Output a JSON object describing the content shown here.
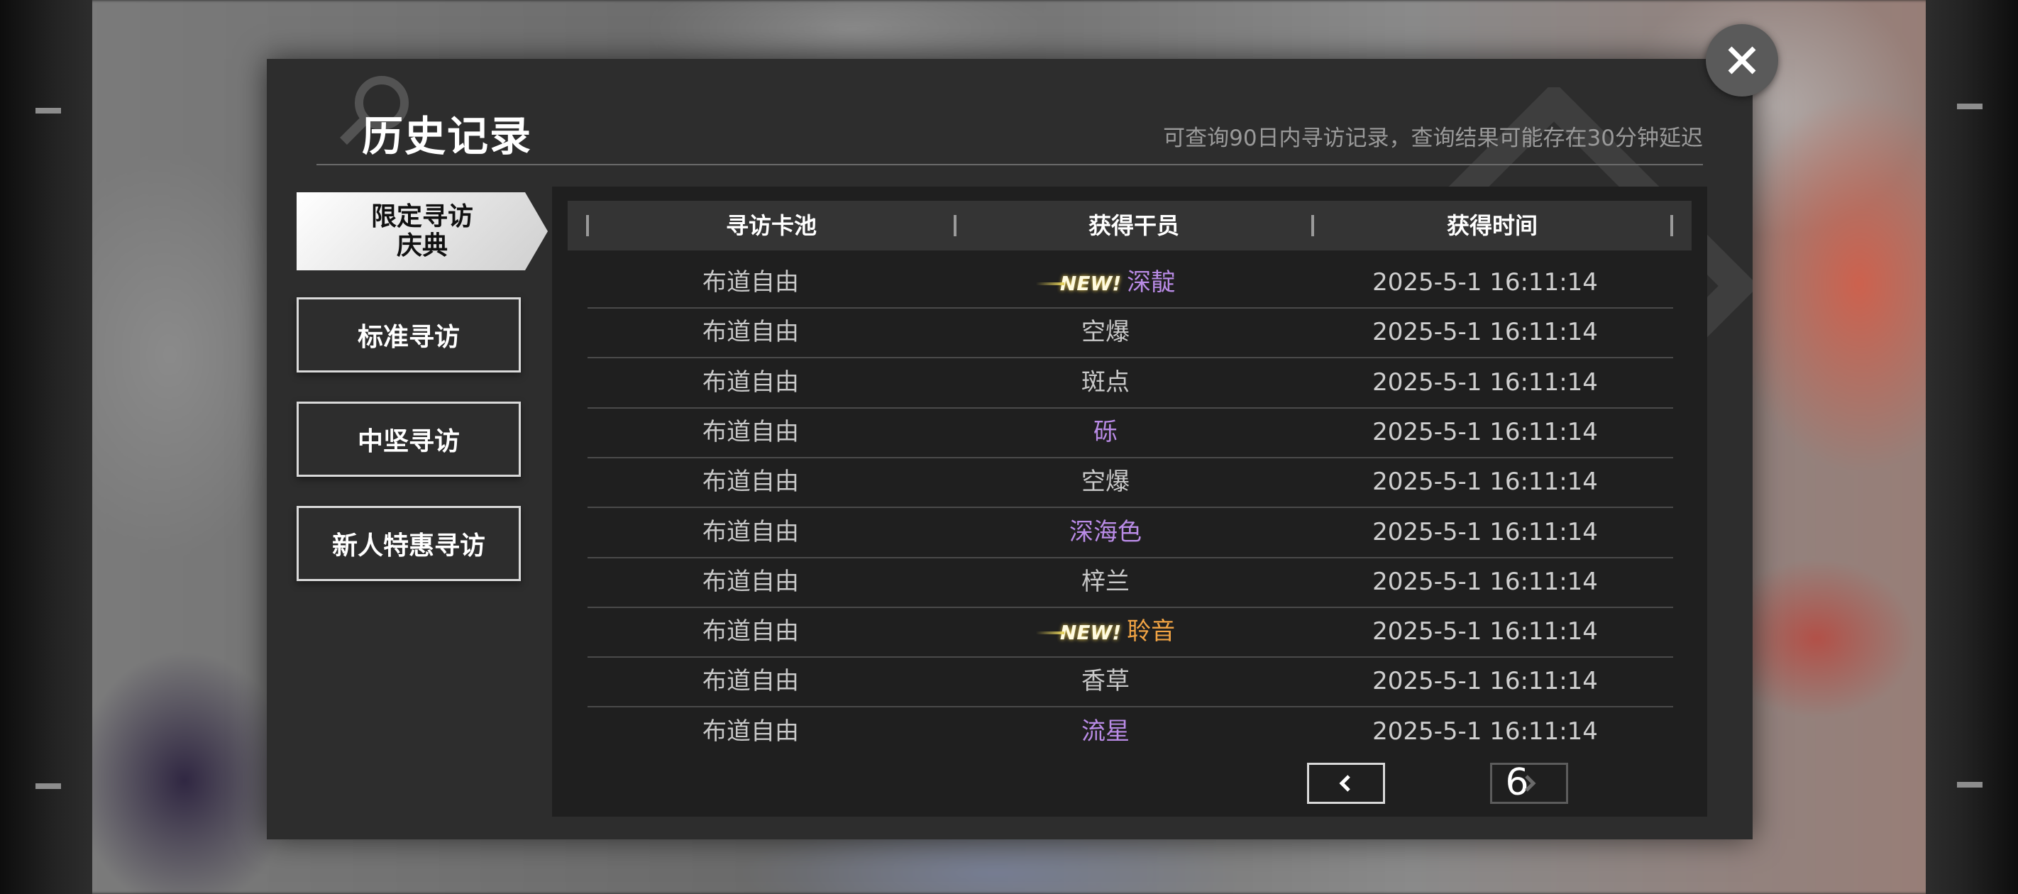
{
  "header": {
    "title": "历史记录",
    "subtitle": "可查询90日内寻访记录，查询结果可能存在30分钟延迟"
  },
  "tabs": [
    {
      "label_line1": "限定寻访",
      "label_line2": "庆典",
      "active": true
    },
    {
      "label": "标准寻访",
      "active": false
    },
    {
      "label": "中坚寻访",
      "active": false
    },
    {
      "label": "新人特惠寻访",
      "active": false
    }
  ],
  "table": {
    "columns": [
      "寻访卡池",
      "获得干员",
      "获得时间"
    ],
    "rows": [
      {
        "pool": "布道自由",
        "operator": "深靛",
        "time": "2025-5-1 16:11:14",
        "new": true,
        "color": "#b98be6"
      },
      {
        "pool": "布道自由",
        "operator": "空爆",
        "time": "2025-5-1 16:11:14",
        "new": false,
        "color": "#c8c8c8"
      },
      {
        "pool": "布道自由",
        "operator": "斑点",
        "time": "2025-5-1 16:11:14",
        "new": false,
        "color": "#c8c8c8"
      },
      {
        "pool": "布道自由",
        "operator": "砾",
        "time": "2025-5-1 16:11:14",
        "new": false,
        "color": "#b98be6"
      },
      {
        "pool": "布道自由",
        "operator": "空爆",
        "time": "2025-5-1 16:11:14",
        "new": false,
        "color": "#c8c8c8"
      },
      {
        "pool": "布道自由",
        "operator": "深海色",
        "time": "2025-5-1 16:11:14",
        "new": false,
        "color": "#b98be6"
      },
      {
        "pool": "布道自由",
        "operator": "梓兰",
        "time": "2025-5-1 16:11:14",
        "new": false,
        "color": "#c8c8c8"
      },
      {
        "pool": "布道自由",
        "operator": "聆音",
        "time": "2025-5-1 16:11:14",
        "new": true,
        "color": "#f2a444"
      },
      {
        "pool": "布道自由",
        "operator": "香草",
        "time": "2025-5-1 16:11:14",
        "new": false,
        "color": "#c8c8c8"
      },
      {
        "pool": "布道自由",
        "operator": "流星",
        "time": "2025-5-1 16:11:14",
        "new": false,
        "color": "#b98be6"
      }
    ],
    "new_badge_label": "NEW!"
  },
  "pager": {
    "current_page": "6",
    "prev_icon": "chevron-left-icon",
    "next_icon": "chevron-right-icon",
    "next_disabled": true
  },
  "colors": {
    "rarity_4": "#b98be6",
    "rarity_5": "#f2a444",
    "rarity_3": "#c8c8c8"
  },
  "close_icon": "close-icon"
}
